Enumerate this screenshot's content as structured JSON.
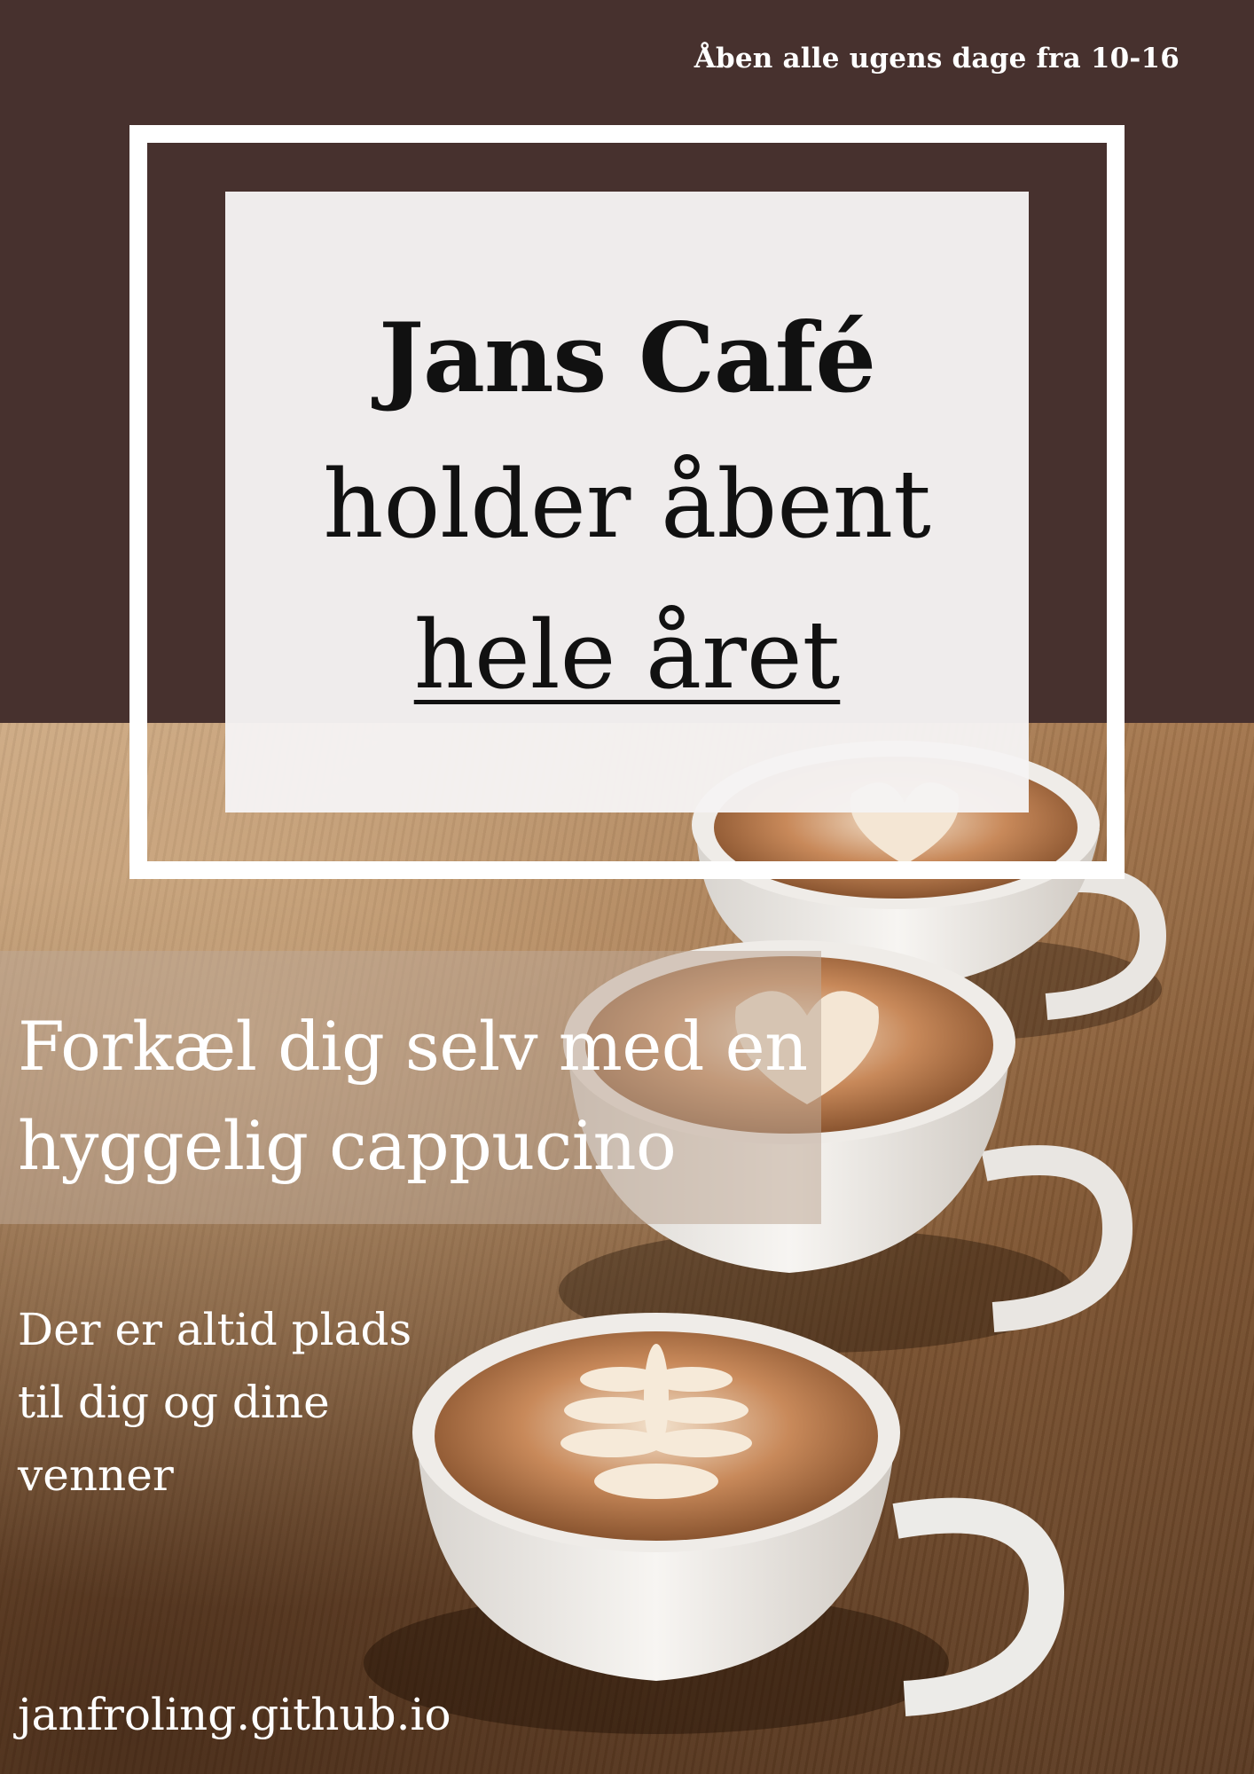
{
  "poster": {
    "hours": "Åben alle ugens dage fra 10-16",
    "title_line1": "Jans Café",
    "title_line2": "holder åbent",
    "title_line3": "hele året",
    "tagline_line1": "Forkæl dig selv med en",
    "tagline_line2": "hyggelig cappucino",
    "invite_line1": "Der er altid plads",
    "invite_line2": "til dig og dine",
    "invite_line3": "venner",
    "website": "janfroling.github.io"
  },
  "colors": {
    "background_brown": "#47312e",
    "frame_white": "#ffffff",
    "card_background": "#f5f3f3",
    "title_text": "#111111",
    "overlay_text": "#ffffff"
  },
  "photo": {
    "subject": "three cappuccino cups with latte art on wooden table"
  }
}
